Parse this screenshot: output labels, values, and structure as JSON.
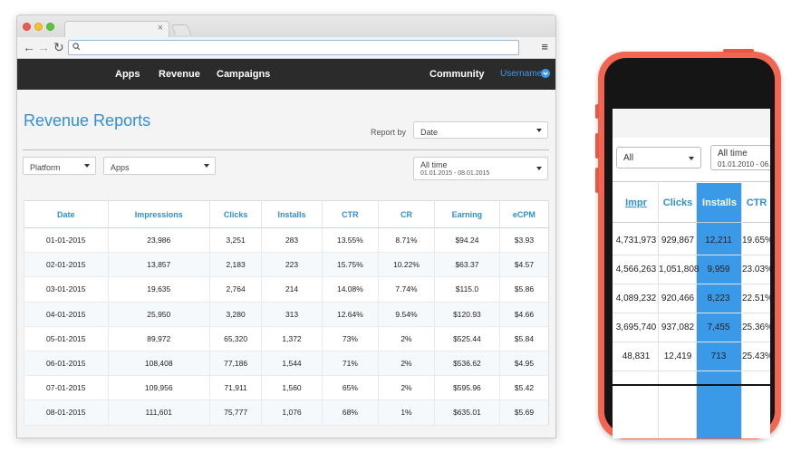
{
  "browser": {
    "tab_close": "×",
    "menu_icon": "≡"
  },
  "nav": {
    "items": [
      "Apps",
      "Revenue",
      "Campaigns"
    ],
    "community": "Community",
    "username": "Username"
  },
  "page": {
    "title": "Revenue Reports",
    "report_by_label": "Report by",
    "report_by_value": "Date",
    "platform": "Platform",
    "apps": "Apps",
    "time_label": "All time",
    "time_range": "01.01.2015 - 08.01.2015"
  },
  "table": {
    "headers": [
      "Date",
      "Impressions",
      "Clicks",
      "Installs",
      "CTR",
      "CR",
      "Earning",
      "eCPM"
    ],
    "rows": [
      [
        "01-01-2015",
        "23,986",
        "3,251",
        "283",
        "13.55%",
        "8.71%",
        "$94.24",
        "$3.93"
      ],
      [
        "02-01-2015",
        "13,857",
        "2,183",
        "223",
        "15.75%",
        "10.22%",
        "$63.37",
        "$4.57"
      ],
      [
        "03-01-2015",
        "19,635",
        "2,764",
        "214",
        "14.08%",
        "7.74%",
        "$115.0",
        "$5.86"
      ],
      [
        "04-01-2015",
        "25,950",
        "3,280",
        "313",
        "12.64%",
        "9.54%",
        "$120.93",
        "$4.66"
      ],
      [
        "05-01-2015",
        "89,972",
        "65,320",
        "1,372",
        "73%",
        "2%",
        "$525.44",
        "$5.84"
      ],
      [
        "06-01-2015",
        "108,408",
        "77,186",
        "1,544",
        "71%",
        "2%",
        "$536.62",
        "$4.95"
      ],
      [
        "07-01-2015",
        "109,956",
        "71,911",
        "1,560",
        "65%",
        "2%",
        "$595.96",
        "$5.42"
      ],
      [
        "08-01-2015",
        "111,601",
        "75,777",
        "1,076",
        "68%",
        "1%",
        "$635.01",
        "$5.69"
      ]
    ]
  },
  "phone": {
    "platform": "All",
    "time_label": "All time",
    "time_range": "01.01.2010 - 06.",
    "headers": [
      "Impr",
      "Clicks",
      "Installs",
      "CTR"
    ],
    "rows": [
      [
        "4,731,973",
        "929,867",
        "12,211",
        "19.65%"
      ],
      [
        "4,566,263",
        "1,051,808",
        "9,959",
        "23.03%"
      ],
      [
        "4,089,232",
        "920,466",
        "8,223",
        "22.51%"
      ],
      [
        "3,695,740",
        "937,082",
        "7,455",
        "25.36%"
      ],
      [
        "48,831",
        "12,419",
        "713",
        "25.43%"
      ]
    ]
  },
  "colors": {
    "accent": "#2f8fd8",
    "navbar": "#2b2b2b",
    "phone_body": "#f26551",
    "highlight_column": "#3b9ae8"
  }
}
